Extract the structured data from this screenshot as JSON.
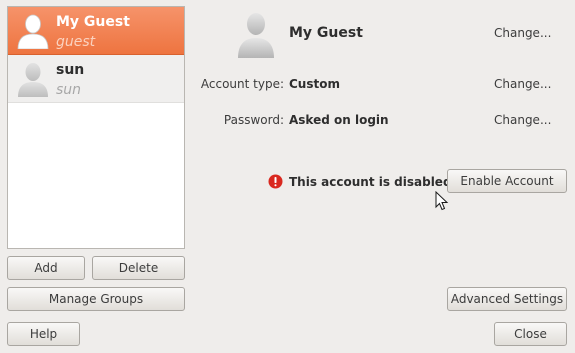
{
  "users": [
    {
      "name": "My Guest",
      "login": "guest",
      "selected": true
    },
    {
      "name": "sun",
      "login": "sun",
      "selected": false
    }
  ],
  "list_buttons": {
    "add": "Add",
    "delete": "Delete",
    "manage_groups": "Manage Groups"
  },
  "footer": {
    "help": "Help",
    "close": "Close"
  },
  "details": {
    "name": "My Guest",
    "name_change": "Change...",
    "account_type_label": "Account type:",
    "account_type_value": "Custom",
    "account_type_change": "Change...",
    "password_label": "Password:",
    "password_value": "Asked on login",
    "password_change": "Change...",
    "disabled_message": "This account is disabled.",
    "enable_button": "Enable Account",
    "advanced_button": "Advanced Settings"
  },
  "colors": {
    "selection": "#ee7440",
    "warning": "#d9281f"
  },
  "icons": {
    "avatar": "user-silhouette-icon",
    "warning": "error-icon",
    "cursor": "mouse-pointer-icon"
  }
}
